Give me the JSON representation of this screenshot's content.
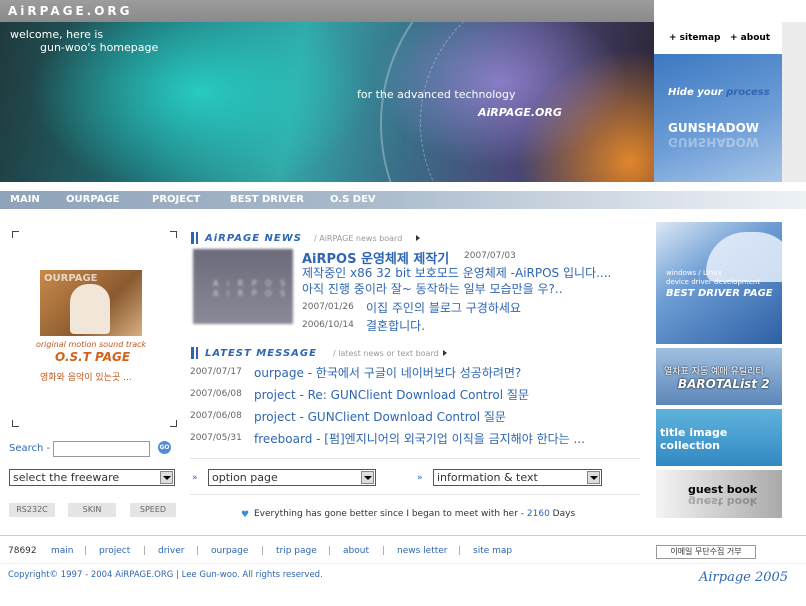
{
  "header": {
    "logo": "AiRPAGE.ORG",
    "welcome_line1": "welcome, here is",
    "welcome_line2": "gun-woo's homepage",
    "tagline": "for the advanced technology",
    "tag_name": "AiRPAGE.ORG"
  },
  "top_links": {
    "sitemap": "+ sitemap",
    "about": "+ about"
  },
  "gunshadow": {
    "hide_prefix": "Hide your ",
    "hide_suffix": "process",
    "name": "GUNSHADOW"
  },
  "nav": [
    "MAIN",
    "OURPAGE",
    "PROJECT",
    "BEST DRIVER",
    "O.S DEV"
  ],
  "ost": {
    "title": "OURPAGE",
    "line1": "original motion sound track",
    "line2": "O.S.T PAGE",
    "line3": "영화와 음악이 있는곳 ..."
  },
  "search": {
    "label": "Search -",
    "value": "",
    "go": "GO"
  },
  "freeware_select": "select the freeware",
  "small_buttons": [
    "RS232C",
    "SKIN",
    "SPEED"
  ],
  "news": {
    "heading": "AiRPAGE NEWS",
    "sub": "/  AiRPAGE news board",
    "image_text1": "A i R P O S",
    "image_text2": "A i R P O S",
    "main_title": "AiRPOS 운영체제 제작기",
    "main_date": "2007/07/03",
    "main_line1": "제작중인 x86 32 bit 보호모드 운영체제 -AiRPOS 입니다....",
    "main_line2": "아직 진행 중이라 잘~ 동작하는 일부 모습만을 우?..",
    "items": [
      {
        "date": "2007/01/26",
        "text": "이집 주인의 블로그 구경하세요"
      },
      {
        "date": "2006/10/14",
        "text": "결혼합니다."
      }
    ]
  },
  "latest": {
    "heading": "LATEST MESSAGE",
    "sub": "/  latest news or text board",
    "items": [
      {
        "date": "2007/07/17",
        "text": "ourpage - 한국에서 구글이 네이버보다 성공하려면?"
      },
      {
        "date": "2007/06/08",
        "text": "project - Re: GUNClient Download Control 질문"
      },
      {
        "date": "2007/06/08",
        "text": "project - GUNClient Download Control 질문"
      },
      {
        "date": "2007/05/31",
        "text": "freeboard - [펌]엔지니어의 외국기업 이직을 금지해야 한다는 ..."
      }
    ]
  },
  "option_select": "option page",
  "info_select": "information & text",
  "days": {
    "text": "Everything has gone better since I began to meet with her -",
    "count": "2160",
    "unit": "Days",
    "icon": "heart-icon"
  },
  "right_banners": {
    "driver_line1": "windows / Linux",
    "driver_line2": "device driver development",
    "driver_line3": "BEST DRIVER PAGE",
    "barotal_line1": "열차표 자동 예매 유틸리티",
    "barotal_line2": "BAROTAList 2",
    "title_image": "title image collection",
    "guestbook": "guest book"
  },
  "footer": {
    "visits": "78692",
    "links": [
      "main",
      "project",
      "driver",
      "ourpage",
      "trip page",
      "about",
      "news letter",
      "site map"
    ],
    "email_button": "이메일 무단수집 거부",
    "copyright": "Copyright© 1997 - 2004 AiRPAGE.ORG | Lee Gun-woo. All rights reserved.",
    "signature": "Airpage 2005"
  },
  "colors": {
    "accent": "#2e66b3",
    "ost": "#d2641a"
  }
}
